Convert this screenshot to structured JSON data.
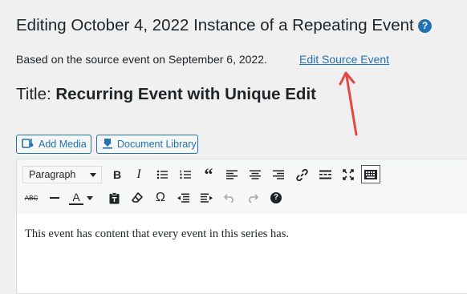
{
  "page": {
    "heading": "Editing October 4, 2022 Instance of a Repeating Event",
    "help_icon": "help-icon",
    "source_text": "Based on the source event on September 6, 2022.",
    "source_link": "Edit Source Event",
    "title_label": "Title:",
    "title_value": "Recurring Event with Unique Edit"
  },
  "buttons": {
    "add_media": "Add Media",
    "document_library": "Document Library"
  },
  "toolbar": {
    "format_select": "Paragraph",
    "row1_icons": [
      "bold-icon",
      "italic-icon",
      "bulleted-list-icon",
      "numbered-list-icon",
      "blockquote-icon",
      "align-left-icon",
      "align-center-icon",
      "align-right-icon",
      "link-icon",
      "read-more-icon",
      "fullscreen-icon",
      "toolbar-toggle-icon"
    ],
    "row2_icons": [
      "strikethrough-icon",
      "horizontal-line-icon",
      "text-color-icon",
      "paste-as-text-icon",
      "clear-formatting-icon",
      "special-character-icon",
      "outdent-icon",
      "indent-icon",
      "undo-icon",
      "redo-icon",
      "keyboard-shortcuts-icon"
    ],
    "glyphs": {
      "bold": "B",
      "italic": "I",
      "blockquote": "“",
      "special_character": "Ω",
      "strikethrough": "ABC",
      "text_color": "A",
      "help": "?"
    }
  },
  "editor": {
    "content": "This event has content that every event in this series has."
  },
  "colors": {
    "link": "#2271b1",
    "annotation_arrow": "#e8473f",
    "background": "#f0f0f1"
  }
}
